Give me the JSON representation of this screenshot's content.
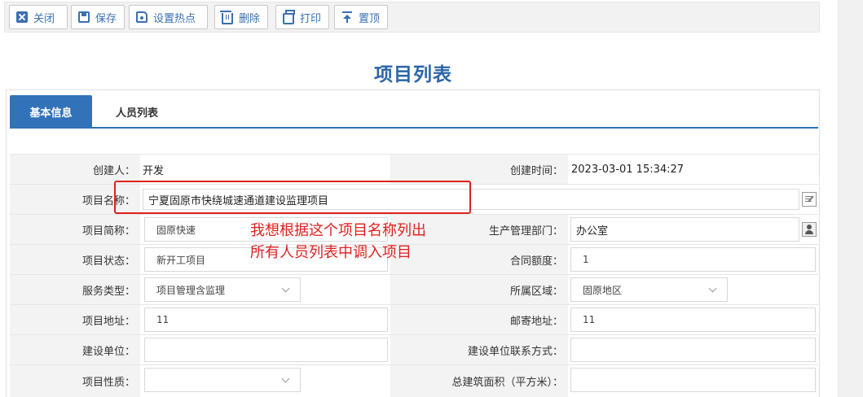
{
  "toolbar": {
    "buttons": [
      {
        "label": "关闭",
        "icon": "close-icon"
      },
      {
        "label": "保存",
        "icon": "save-icon"
      },
      {
        "label": "设置热点",
        "icon": "hotspot-icon"
      },
      {
        "label": "删除",
        "icon": "trash-icon"
      },
      {
        "label": "打印",
        "icon": "print-icon"
      },
      {
        "label": "置顶",
        "icon": "pin-top-icon"
      }
    ]
  },
  "page": {
    "title": "项目列表"
  },
  "tabs": [
    {
      "label": "基本信息",
      "active": true
    },
    {
      "label": "人员列表",
      "active": false
    }
  ],
  "form": {
    "creator": {
      "label": "创建人：",
      "value": "开发"
    },
    "created_time": {
      "label": "创建时间：",
      "value": "2023-03-01 15:34:27"
    },
    "project_name": {
      "label": "项目名称：",
      "value": "宁夏固原市快绕城速通道建设监理项目"
    },
    "project_short": {
      "label": "项目简称：",
      "value": "固原快速"
    },
    "prod_dept": {
      "label": "生产管理部门：",
      "value": "办公室"
    },
    "project_status": {
      "label": "项目状态：",
      "value": "新开工项目"
    },
    "contract_amount": {
      "label": "合同额度：",
      "value": "1"
    },
    "service_type": {
      "label": "服务类型：",
      "value": "项目管理含监理"
    },
    "region": {
      "label": "所属区域：",
      "value": "固原地区"
    },
    "project_address": {
      "label": "项目地址：",
      "value": "11"
    },
    "mail_address": {
      "label": "邮寄地址：",
      "value": "11"
    },
    "build_unit": {
      "label": "建设单位：",
      "value": ""
    },
    "build_unit_contact": {
      "label": "建设单位联系方式：",
      "value": ""
    },
    "project_nature": {
      "label": "项目性质：",
      "value": ""
    },
    "total_area": {
      "label": "总建筑面积（平方米）：",
      "value": ""
    }
  },
  "annotation": {
    "line1": "我想根据这个项目名称列出",
    "line2": "所有人员列表中调入项目",
    "color": "#e02020"
  },
  "colors": {
    "accent": "#3172b9",
    "title": "#2b65a6"
  }
}
